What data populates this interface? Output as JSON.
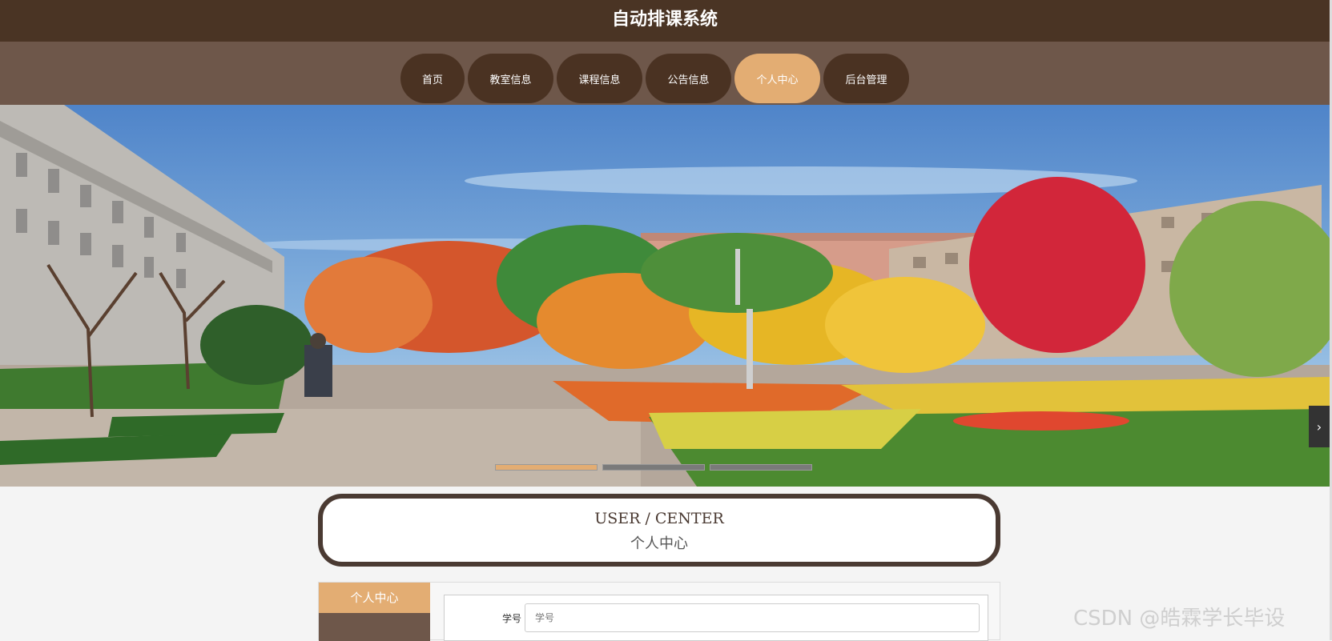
{
  "site": {
    "title": "自动排课系统"
  },
  "nav": {
    "items": [
      {
        "label": "首页"
      },
      {
        "label": "教室信息"
      },
      {
        "label": "课程信息"
      },
      {
        "label": "公告信息"
      },
      {
        "label": "个人中心",
        "active": true
      },
      {
        "label": "后台管理"
      }
    ]
  },
  "banner": {
    "next_icon": "›",
    "slide_count": 3,
    "active_slide": 1
  },
  "section": {
    "title_en": "USER / CENTER",
    "title_cn": "个人中心"
  },
  "side_menu": {
    "title": "个人中心"
  },
  "form": {
    "field_label": "学号",
    "field_placeholder": "学号"
  },
  "watermark": "CSDN @皓霖学长毕设",
  "colors": {
    "header": "#4a3424",
    "nav_bg": "#6e574a",
    "nav_item": "#4a3222",
    "accent": "#e3ad73"
  }
}
